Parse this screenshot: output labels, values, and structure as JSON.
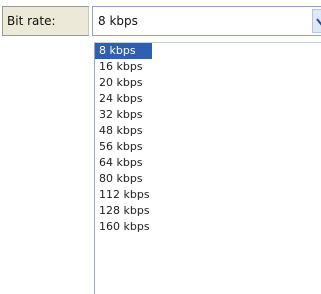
{
  "bitrate_field": {
    "label": "Bit rate:",
    "selected_value": "8 kbps",
    "arrow_icon": "chevron-down-icon"
  },
  "dropdown": {
    "options": [
      "8 kbps",
      "16 kbps",
      "20 kbps",
      "24 kbps",
      "32 kbps",
      "48 kbps",
      "56 kbps",
      "64 kbps",
      "80 kbps",
      "112 kbps",
      "128 kbps",
      "160 kbps"
    ],
    "highlighted_index": 0
  },
  "colors": {
    "label_bg": "#ece9d8",
    "select_border": "#8ea2c1",
    "highlight_bg": "#2f5fb3",
    "highlight_text": "#ffffff"
  }
}
